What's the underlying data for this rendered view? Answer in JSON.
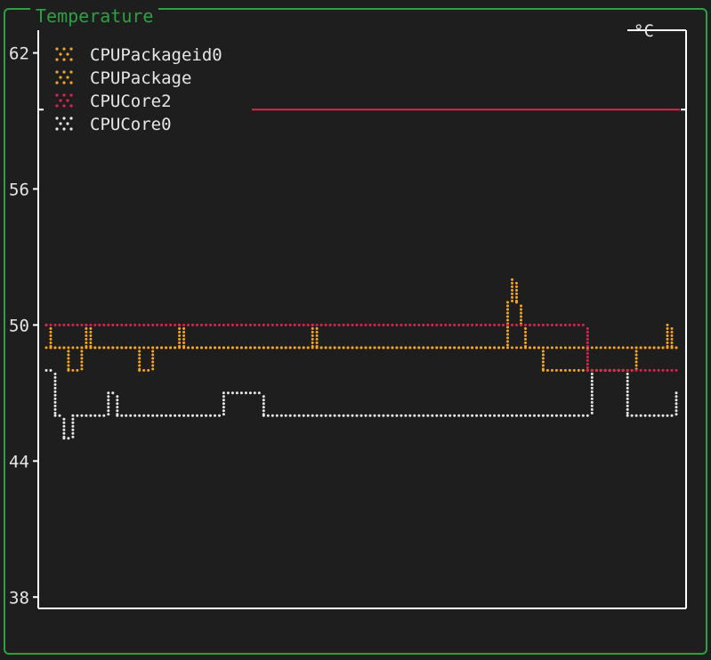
{
  "widget": {
    "title": "Temperature"
  },
  "colors": {
    "frame": "#2ea043",
    "axis": "#ffffff",
    "CPUPackageid0": "#f5a623",
    "CPUPackage": "#f5a623",
    "CPUCore2": "#e0234e",
    "CPUCore0": "#e8e8e8",
    "threshold": "#e0234e"
  },
  "chart_data": {
    "type": "line",
    "title": "Temperature",
    "unit": "°C",
    "xlabel": "",
    "ylabel": "",
    "ylim": [
      37.5,
      63
    ],
    "yticks": [
      {
        "value": 62,
        "label": "62"
      },
      {
        "value": 56,
        "label": "56"
      },
      {
        "value": 50,
        "label": "50"
      },
      {
        "value": 44,
        "label": "44"
      },
      {
        "value": 38,
        "label": "38"
      }
    ],
    "threshold": 59.5,
    "legend_position": "top-left",
    "grid": false,
    "x": [
      0,
      1,
      2,
      3,
      4,
      5,
      6,
      7,
      8,
      9,
      10,
      11,
      12,
      13,
      14,
      15,
      16,
      17,
      18,
      19,
      20,
      21,
      22,
      23,
      24,
      25,
      26,
      27,
      28,
      29,
      30,
      31,
      32,
      33,
      34,
      35,
      36,
      37,
      38,
      39,
      40,
      41,
      42,
      43,
      44,
      45,
      46,
      47,
      48,
      49,
      50,
      51,
      52,
      53,
      54,
      55,
      56,
      57,
      58,
      59,
      60,
      61,
      62,
      63,
      64,
      65,
      66,
      67,
      68,
      69,
      70,
      71,
      72,
      73,
      74,
      75,
      76,
      77,
      78,
      79,
      80,
      81,
      82,
      83,
      84,
      85,
      86,
      87,
      88,
      89,
      90,
      91,
      92,
      93,
      94,
      95,
      96,
      97,
      98,
      99,
      100,
      101,
      102,
      103,
      104,
      105,
      106,
      107,
      108,
      109,
      110,
      111,
      112,
      113,
      114,
      115,
      116,
      117,
      118,
      119,
      120,
      121,
      122,
      123,
      124,
      125,
      126,
      127,
      128,
      129,
      130,
      131,
      132,
      133,
      134,
      135,
      136,
      137,
      138,
      139,
      140,
      141,
      142
    ],
    "series": [
      {
        "name": "CPUPackageid0",
        "values": [
          50,
          49,
          49,
          49,
          49,
          49,
          49,
          49,
          49,
          50,
          49,
          49,
          49,
          49,
          49,
          49,
          49,
          49,
          49,
          49,
          49,
          49,
          49,
          49,
          49,
          49,
          49,
          49,
          49,
          49,
          50,
          49,
          49,
          49,
          49,
          49,
          49,
          49,
          49,
          49,
          49,
          49,
          49,
          49,
          49,
          49,
          49,
          49,
          49,
          49,
          49,
          49,
          49,
          49,
          49,
          49,
          49,
          49,
          49,
          49,
          50,
          49,
          49,
          49,
          49,
          49,
          49,
          49,
          49,
          49,
          49,
          49,
          49,
          49,
          49,
          49,
          49,
          49,
          49,
          49,
          49,
          49,
          49,
          49,
          49,
          49,
          49,
          49,
          49,
          49,
          49,
          49,
          49,
          49,
          49,
          49,
          49,
          49,
          49,
          49,
          49,
          49,
          49,
          49,
          49,
          49,
          49,
          49,
          49,
          49,
          49,
          49,
          49,
          49,
          49,
          49,
          49,
          49,
          49,
          49,
          49,
          49,
          49,
          49,
          49,
          49,
          49,
          49,
          49,
          49,
          49,
          49,
          49,
          49,
          49,
          49,
          49,
          49,
          49,
          49,
          50,
          49,
          49
        ]
      },
      {
        "name": "CPUPackage",
        "values": [
          49,
          49,
          49,
          49,
          49,
          48,
          48,
          48,
          49,
          49,
          49,
          49,
          49,
          49,
          49,
          49,
          49,
          49,
          49,
          49,
          49,
          48,
          48,
          48,
          49,
          49,
          49,
          49,
          49,
          49,
          49,
          49,
          49,
          49,
          49,
          49,
          49,
          49,
          49,
          49,
          49,
          49,
          49,
          49,
          49,
          49,
          49,
          49,
          49,
          49,
          49,
          49,
          49,
          49,
          49,
          49,
          49,
          49,
          49,
          49,
          49,
          49,
          49,
          49,
          49,
          49,
          49,
          49,
          49,
          49,
          49,
          49,
          49,
          49,
          49,
          49,
          49,
          49,
          49,
          49,
          49,
          49,
          49,
          49,
          49,
          49,
          49,
          49,
          49,
          49,
          49,
          49,
          49,
          49,
          49,
          49,
          49,
          49,
          49,
          49,
          49,
          49,
          49,
          49,
          51,
          52,
          51,
          50,
          49,
          49,
          49,
          49,
          48,
          48,
          48,
          48,
          48,
          48,
          48,
          48,
          48,
          48,
          48,
          48,
          48,
          48,
          48,
          48,
          48,
          48,
          48,
          48,
          48,
          49,
          49,
          49,
          49,
          49,
          49,
          49,
          49,
          49,
          49
        ]
      },
      {
        "name": "CPUCore2",
        "values": [
          50,
          50,
          50,
          50,
          50,
          50,
          50,
          50,
          50,
          50,
          50,
          50,
          50,
          50,
          50,
          50,
          50,
          50,
          50,
          50,
          50,
          50,
          50,
          50,
          50,
          50,
          50,
          50,
          50,
          50,
          50,
          50,
          50,
          50,
          50,
          50,
          50,
          50,
          50,
          50,
          50,
          50,
          50,
          50,
          50,
          50,
          50,
          50,
          50,
          50,
          50,
          50,
          50,
          50,
          50,
          50,
          50,
          50,
          50,
          50,
          50,
          50,
          50,
          50,
          50,
          50,
          50,
          50,
          50,
          50,
          50,
          50,
          50,
          50,
          50,
          50,
          50,
          50,
          50,
          50,
          50,
          50,
          50,
          50,
          50,
          50,
          50,
          50,
          50,
          50,
          50,
          50,
          50,
          50,
          50,
          50,
          50,
          50,
          50,
          50,
          50,
          50,
          50,
          50,
          50,
          50,
          50,
          50,
          50,
          50,
          50,
          50,
          50,
          50,
          50,
          50,
          50,
          50,
          50,
          50,
          50,
          50,
          48,
          48,
          48,
          48,
          48,
          48,
          48,
          48,
          48,
          48,
          48,
          48,
          48,
          48,
          48,
          48,
          48,
          48,
          48,
          48,
          48
        ]
      },
      {
        "name": "CPUCore0",
        "values": [
          48,
          48,
          46,
          46,
          45,
          45,
          46,
          46,
          46,
          46,
          46,
          46,
          46,
          46,
          47,
          47,
          46,
          46,
          46,
          46,
          46,
          46,
          46,
          46,
          46,
          46,
          46,
          46,
          46,
          46,
          46,
          46,
          46,
          46,
          46,
          46,
          46,
          46,
          46,
          46,
          47,
          47,
          47,
          47,
          47,
          47,
          47,
          47,
          47,
          46,
          46,
          46,
          46,
          46,
          46,
          46,
          46,
          46,
          46,
          46,
          46,
          46,
          46,
          46,
          46,
          46,
          46,
          46,
          46,
          46,
          46,
          46,
          46,
          46,
          46,
          46,
          46,
          46,
          46,
          46,
          46,
          46,
          46,
          46,
          46,
          46,
          46,
          46,
          46,
          46,
          46,
          46,
          46,
          46,
          46,
          46,
          46,
          46,
          46,
          46,
          46,
          46,
          46,
          46,
          46,
          46,
          46,
          46,
          46,
          46,
          46,
          46,
          46,
          46,
          46,
          46,
          46,
          46,
          46,
          46,
          46,
          46,
          46,
          48,
          48,
          48,
          48,
          48,
          48,
          48,
          48,
          46,
          46,
          46,
          46,
          46,
          46,
          46,
          46,
          46,
          46,
          46,
          47
        ]
      }
    ]
  }
}
